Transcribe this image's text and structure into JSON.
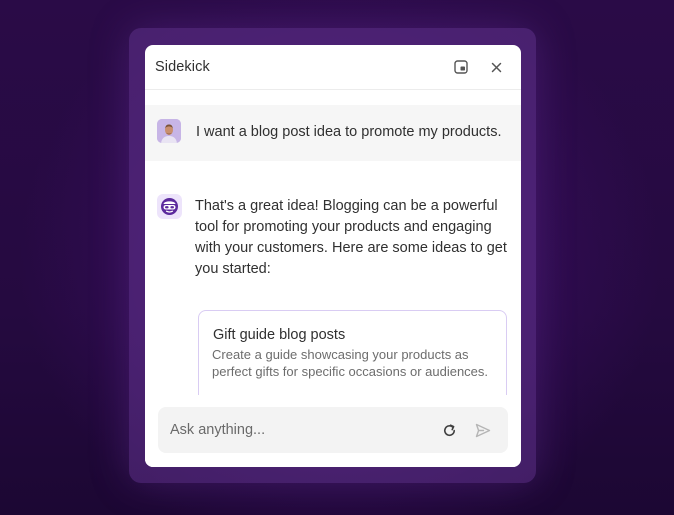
{
  "panel": {
    "title": "Sidekick",
    "pip_icon": "picture-in-picture-icon",
    "close_icon": "close-icon"
  },
  "conversation": {
    "user_message": "I want a blog post idea to promote my products.",
    "assistant_message": "That's a great idea! Blogging can be a powerful tool for promoting your products and engaging with your customers. Here are some ideas to get you started:",
    "ideas": [
      {
        "title": "Gift guide blog posts",
        "description": "Create a guide showcasing your products as perfect gifts for specific occasions or audiences."
      }
    ]
  },
  "composer": {
    "placeholder": "Ask anything...",
    "refresh_icon": "refresh-icon",
    "send_icon": "send-icon"
  },
  "colors": {
    "background": "#2a0b47",
    "accent": "#5c2a9d",
    "card_border": "#d9ccf3"
  }
}
